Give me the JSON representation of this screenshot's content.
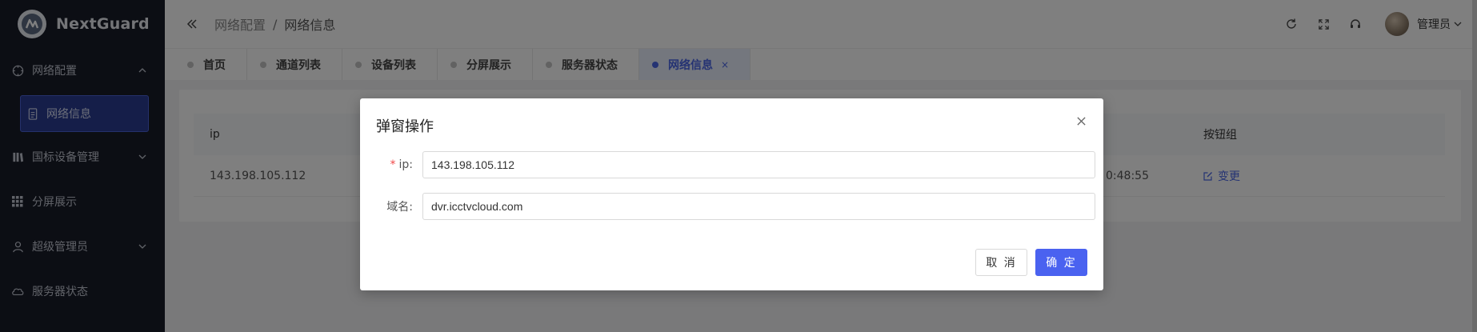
{
  "app": {
    "name": "NextGuard"
  },
  "sidebar": {
    "items": [
      {
        "label": "网络配置",
        "expanded": true,
        "children": [
          {
            "label": "网络信息",
            "active": true
          }
        ]
      },
      {
        "label": "国标设备管理",
        "expanded": false
      },
      {
        "label": "分屏展示"
      },
      {
        "label": "超级管理员",
        "expanded": false
      },
      {
        "label": "服务器状态"
      }
    ]
  },
  "header": {
    "breadcrumb": [
      "网络配置",
      "网络信息"
    ],
    "breadcrumb_sep": "/",
    "user_name": "管理员"
  },
  "tabs": [
    {
      "label": "首页"
    },
    {
      "label": "通道列表"
    },
    {
      "label": "设备列表"
    },
    {
      "label": "分屏展示"
    },
    {
      "label": "服务器状态"
    },
    {
      "label": "网络信息",
      "active": true,
      "close": "×"
    }
  ],
  "table": {
    "columns": {
      "ip": "ip",
      "ops": "按钮组"
    },
    "rows": [
      {
        "ip": "143.198.105.112",
        "time_fragment": "0:48:55",
        "action": "变更"
      }
    ]
  },
  "modal": {
    "title": "弹窗操作",
    "fields": [
      {
        "label": "ip:",
        "required": "*",
        "value": "143.198.105.112"
      },
      {
        "label": "域名:",
        "value": "dvr.icctvcloud.com"
      }
    ],
    "cancel_label": "取 消",
    "ok_label": "确 定"
  },
  "colors": {
    "primary": "#4a66e6",
    "sidebar_bg": "#181c29",
    "required": "#f04848"
  }
}
